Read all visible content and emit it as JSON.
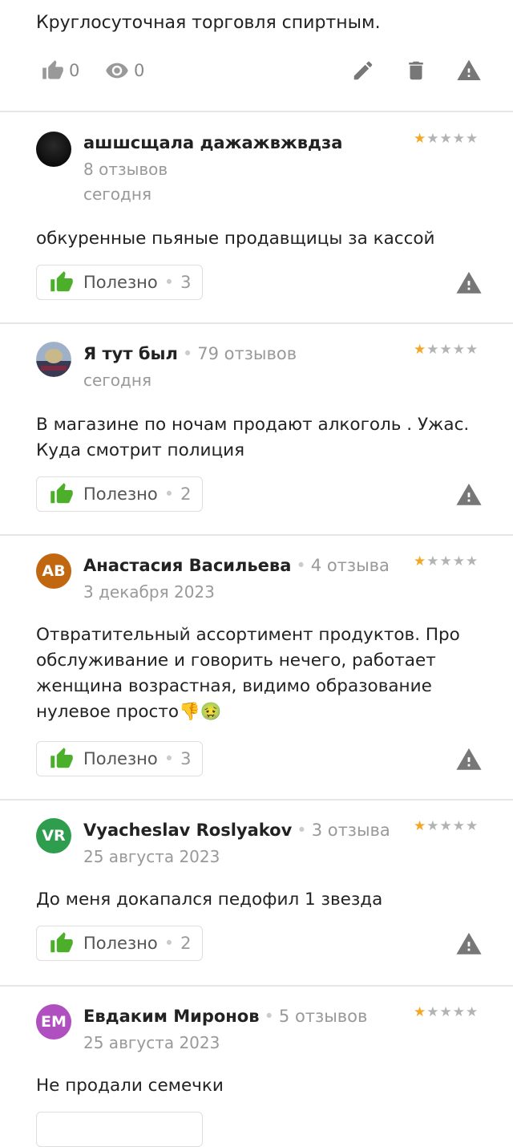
{
  "top_review": {
    "text": "Круглосуточная торговля спиртным.",
    "likes": "0",
    "views": "0"
  },
  "useful_label": "Полезно",
  "dot": "•",
  "colors": {
    "star": "#f5a623",
    "like": "#4caf2a",
    "warn": "#777777"
  },
  "reviews": [
    {
      "author": "ашшсщала дажажвжвдза",
      "count": "8 отзывов",
      "date": "сегодня",
      "rating": 1,
      "text": "обкуренные пьяные продавщицы за кассой",
      "useful_count": "3",
      "avatar_initials": "",
      "avatar_color": "#111111"
    },
    {
      "author": "Я тут был",
      "count": "79 отзывов",
      "date": "сегодня",
      "rating": 1,
      "text": "В магазине по ночам продают алкоголь . Ужас. Куда смотрит полиция",
      "useful_count": "2",
      "avatar_initials": "",
      "avatar_color": "#6b7b95"
    },
    {
      "author": "Анастасия Васильева",
      "count": "4 отзыва",
      "date": "3 декабря 2023",
      "rating": 1,
      "text": "Отвратительный ассортимент продуктов. Про обслуживание и говорить нечего, работает женщина возрастная, видимо образование нулевое просто👎🤢",
      "useful_count": "3",
      "avatar_initials": "АВ",
      "avatar_color": "#c0670f"
    },
    {
      "author": "Vyacheslav Roslyakov",
      "count": "3 отзыва",
      "date": "25 августа 2023",
      "rating": 1,
      "text": "До меня докапался педофил 1 звезда",
      "useful_count": "2",
      "avatar_initials": "VR",
      "avatar_color": "#2e9e4e"
    },
    {
      "author": "Евдаким Миронов",
      "count": "5 отзывов",
      "date": "25 августа 2023",
      "rating": 1,
      "text": "Не продали семечки",
      "useful_count": "",
      "avatar_initials": "ЕМ",
      "avatar_color": "#b04fc0"
    }
  ]
}
